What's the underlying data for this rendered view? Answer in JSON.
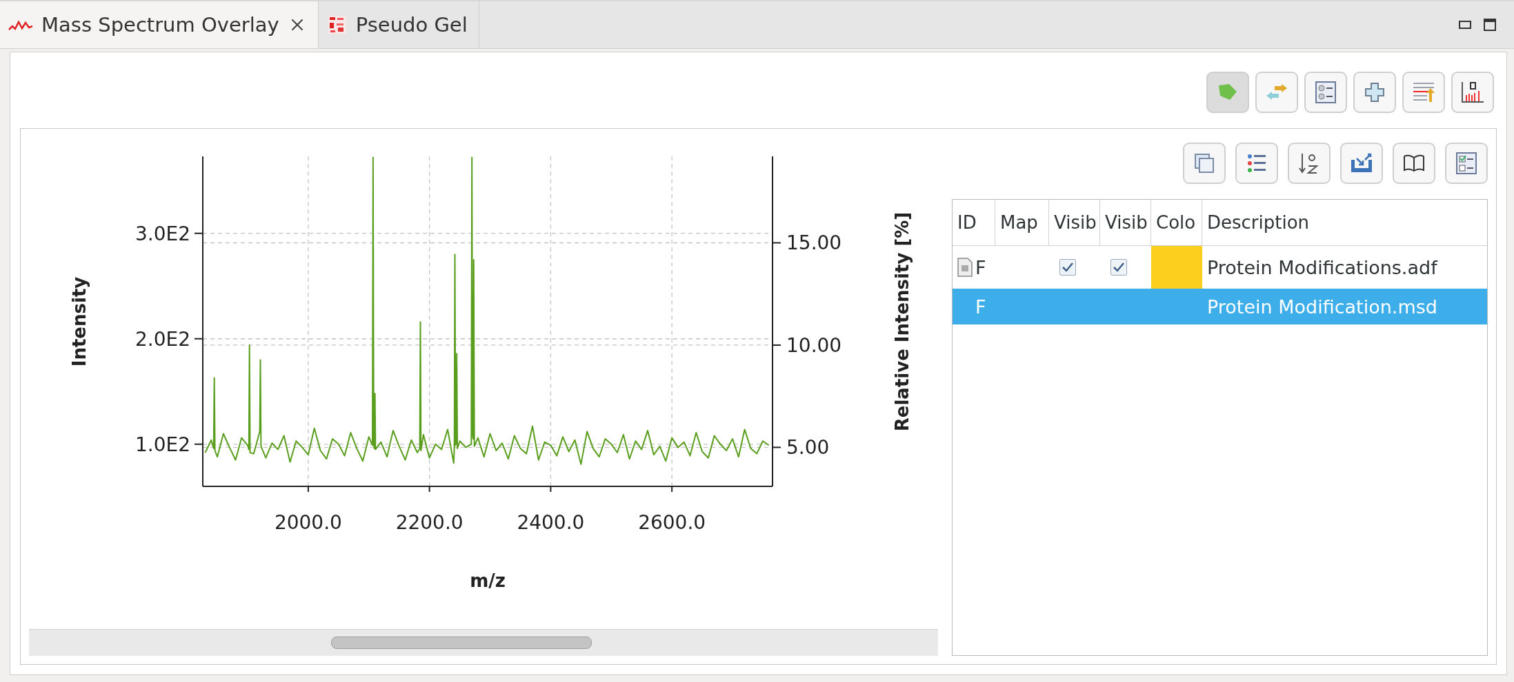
{
  "tabs": [
    {
      "label": "Mass Spectrum Overlay",
      "selected": true
    },
    {
      "label": "Pseudo Gel",
      "selected": false
    }
  ],
  "toolbar": [
    {
      "selected": true
    },
    {
      "selected": false
    },
    {
      "selected": false
    },
    {
      "selected": false
    },
    {
      "selected": false
    },
    {
      "selected": false
    }
  ],
  "chart": {
    "right_axis": {
      "title": "Relative Intensity [%]",
      "ticks": [
        "15.00",
        "10.00",
        "5.00"
      ]
    },
    "chart_data": {
      "type": "line",
      "grid": true,
      "xlabel": "m/z",
      "ylabel": "Intensity",
      "xlim": [
        1826,
        2766
      ],
      "ylim": [
        60,
        373
      ],
      "xticks": [
        {
          "value": 2000,
          "label": "2000.0"
        },
        {
          "value": 2200,
          "label": "2200.0"
        },
        {
          "value": 2400,
          "label": "2400.0"
        },
        {
          "value": 2600,
          "label": "2600.0"
        }
      ],
      "yticks": [
        {
          "value": 100,
          "label": "1.0E2"
        },
        {
          "value": 200,
          "label": "2.0E2"
        },
        {
          "value": 300,
          "label": "3.0E2"
        }
      ],
      "x": [
        1830,
        1840,
        1844,
        1845,
        1846,
        1850,
        1860,
        1870,
        1880,
        1890,
        1900,
        1902,
        1903,
        1904,
        1910,
        1920,
        1921,
        1922,
        1930,
        1940,
        1950,
        1960,
        1970,
        1980,
        1990,
        2000,
        2010,
        2020,
        2030,
        2040,
        2050,
        2060,
        2070,
        2080,
        2090,
        2100,
        2106,
        2107,
        2108,
        2109,
        2110,
        2111,
        2120,
        2130,
        2140,
        2150,
        2160,
        2170,
        2180,
        2184,
        2185,
        2186,
        2190,
        2200,
        2210,
        2220,
        2230,
        2240,
        2241,
        2242,
        2243,
        2244,
        2245,
        2246,
        2250,
        2260,
        2269,
        2270,
        2271,
        2272,
        2273,
        2274,
        2280,
        2290,
        2300,
        2310,
        2320,
        2330,
        2340,
        2350,
        2360,
        2370,
        2380,
        2390,
        2400,
        2410,
        2420,
        2430,
        2440,
        2450,
        2460,
        2470,
        2480,
        2490,
        2500,
        2510,
        2520,
        2530,
        2540,
        2550,
        2560,
        2570,
        2580,
        2590,
        2600,
        2610,
        2620,
        2630,
        2640,
        2650,
        2660,
        2670,
        2680,
        2690,
        2700,
        2710,
        2720,
        2730,
        2740,
        2750,
        2760
      ],
      "series": [
        {
          "color": "#5a9e1e",
          "values": [
            92,
            104,
            96,
            163,
            94,
            88,
            110,
            97,
            85,
            106,
            99,
            95,
            194,
            92,
            91,
            112,
            180,
            98,
            87,
            101,
            95,
            108,
            83,
            103,
            97,
            90,
            115,
            94,
            86,
            105,
            100,
            89,
            111,
            96,
            84,
            107,
            99,
            372,
            100,
            96,
            148,
            95,
            102,
            88,
            113,
            98,
            85,
            104,
            92,
            96,
            216,
            94,
            109,
            87,
            100,
            95,
            114,
            82,
            97,
            280,
            99,
            101,
            186,
            96,
            103,
            97,
            100,
            372,
            110,
            105,
            275,
            98,
            106,
            88,
            110,
            94,
            101,
            86,
            108,
            96,
            91,
            117,
            85,
            102,
            99,
            89,
            107,
            93,
            104,
            81,
            112,
            96,
            88,
            105,
            100,
            92,
            109,
            86,
            103,
            95,
            113,
            90,
            98,
            84,
            106,
            97,
            102,
            89,
            111,
            93,
            87,
            108,
            100,
            94,
            105,
            88,
            114,
            96,
            91,
            103,
            99
          ]
        }
      ]
    }
  },
  "table": {
    "columns": [
      "ID",
      "Map",
      "Visib",
      "Visib",
      "Colo",
      "Description"
    ],
    "rows": [
      {
        "id": "F",
        "visible_1": true,
        "visible_2": true,
        "color": "#fccf1f",
        "description": "Protein Modifications.adf",
        "selected": false
      },
      {
        "id": "F",
        "description": "Protein Modification.msd",
        "selected": true
      }
    ]
  }
}
